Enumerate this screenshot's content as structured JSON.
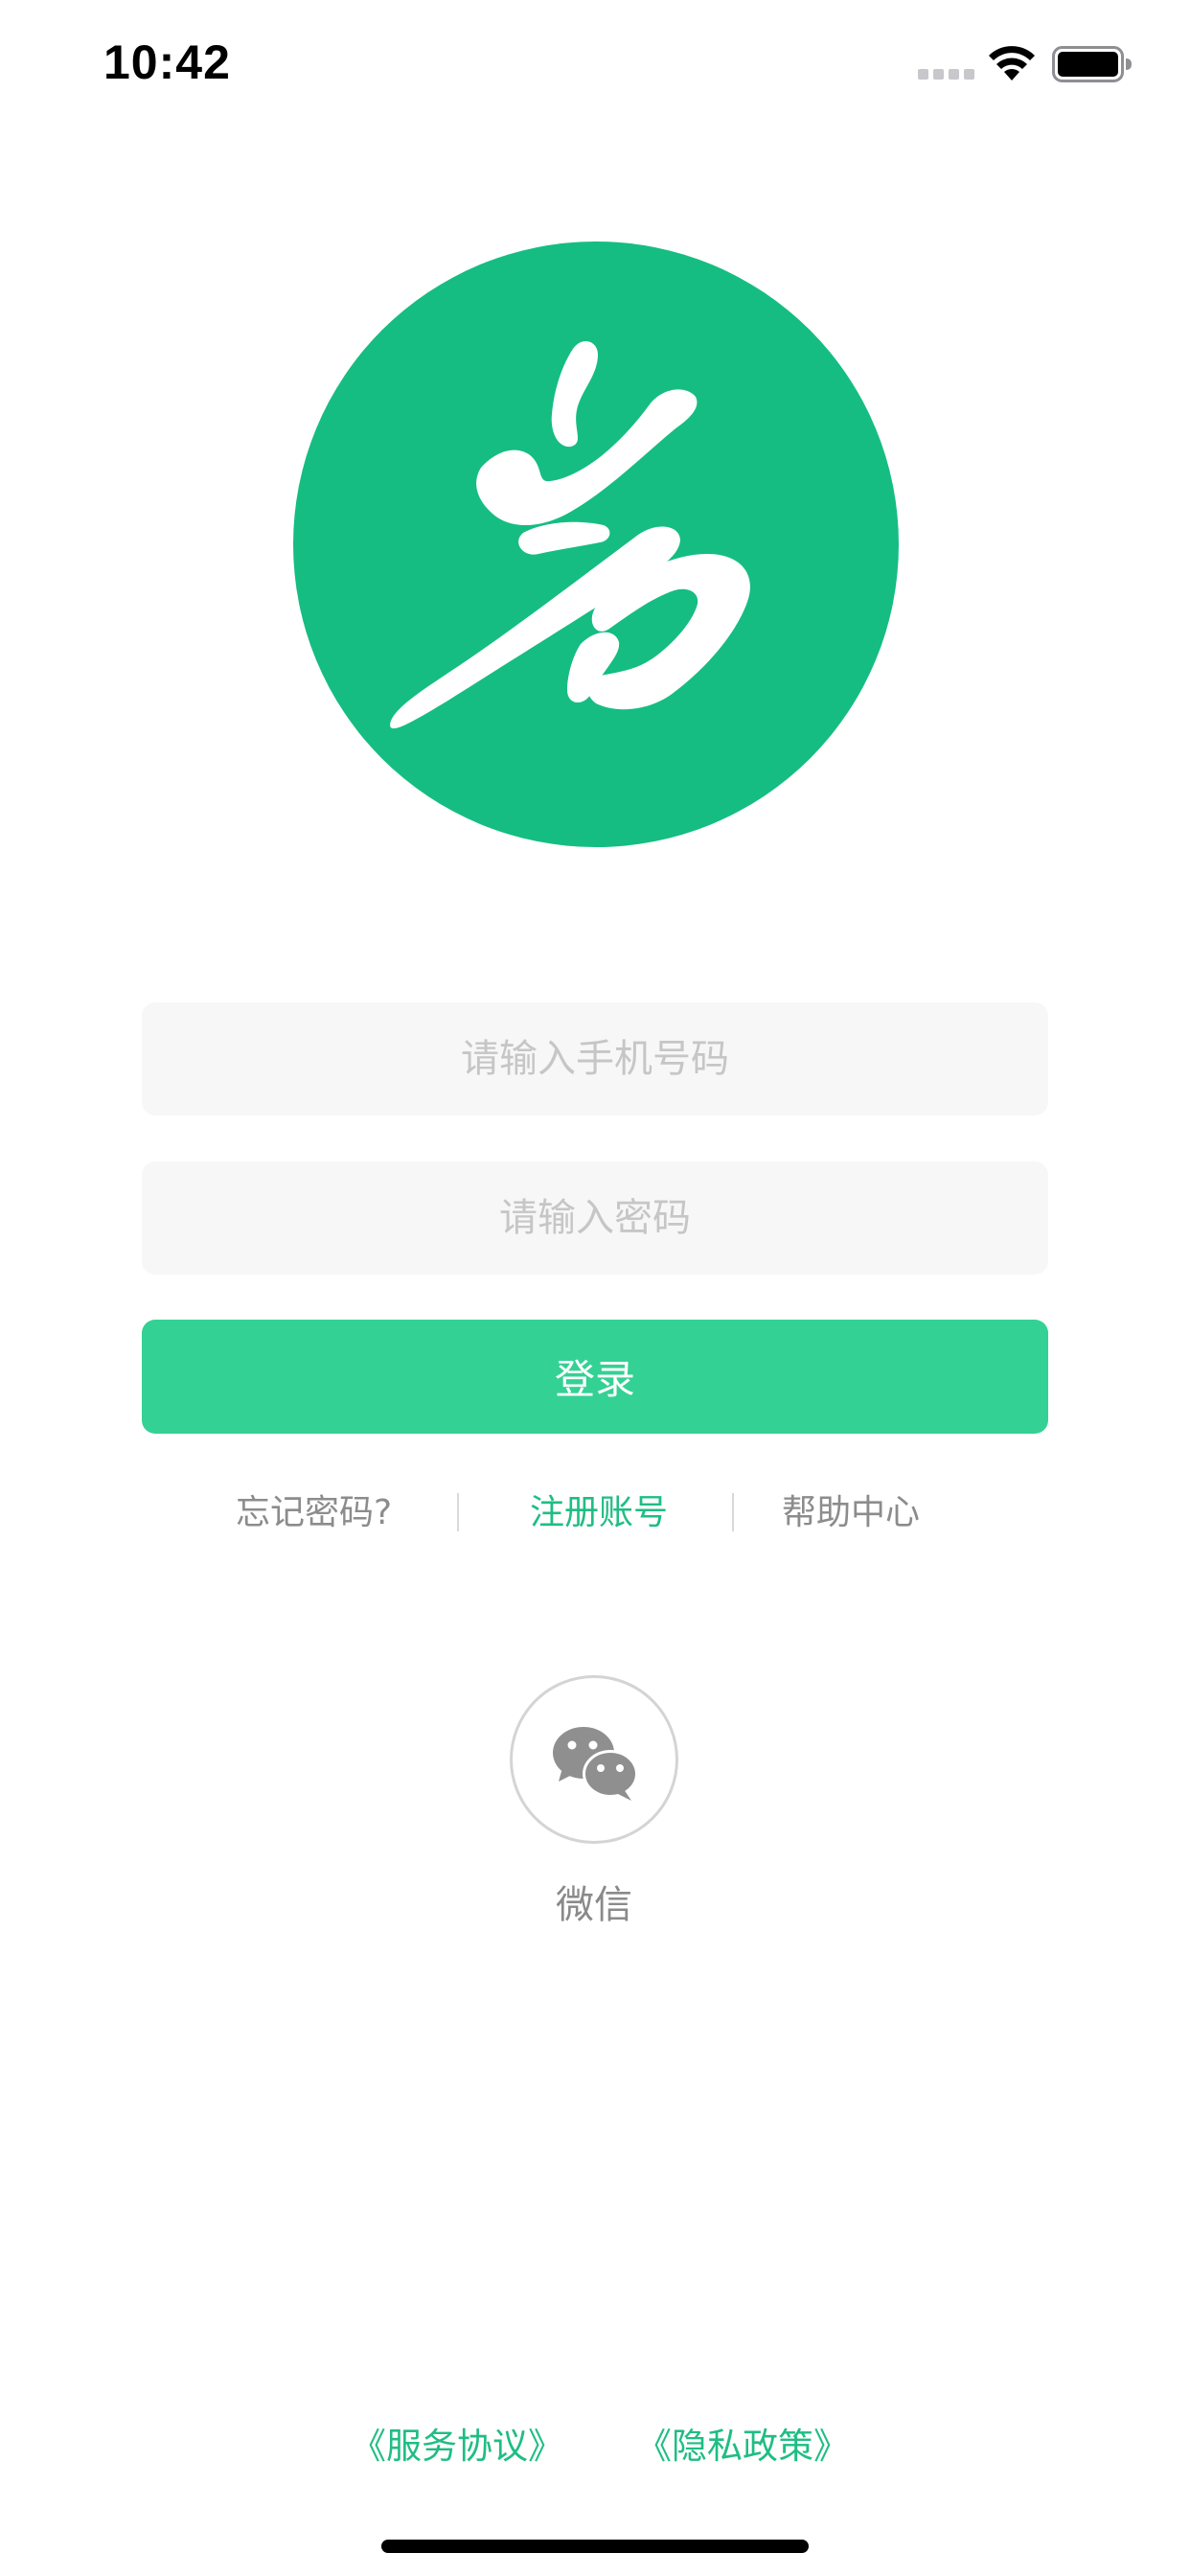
{
  "status_bar": {
    "time": "10:42",
    "icons": [
      "cell-signal-icon",
      "wifi-icon",
      "battery-icon"
    ]
  },
  "logo": {
    "icon": "calligraphy-logo",
    "background_color": "#15bd82"
  },
  "login_form": {
    "phone_placeholder": "请输入手机号码",
    "phone_value": "",
    "password_placeholder": "请输入密码",
    "password_value": "",
    "login_label": "登录",
    "login_color": "#34d194"
  },
  "links": {
    "forgot_password": "忘记密码?",
    "register": "注册账号",
    "help_center": "帮助中心",
    "accent_color": "#1fbd84"
  },
  "third_party_login": {
    "wechat_icon": "wechat-icon",
    "wechat_label": "微信"
  },
  "footer": {
    "service_agreement": "《服务协议》",
    "privacy_policy": "《隐私政策》"
  }
}
